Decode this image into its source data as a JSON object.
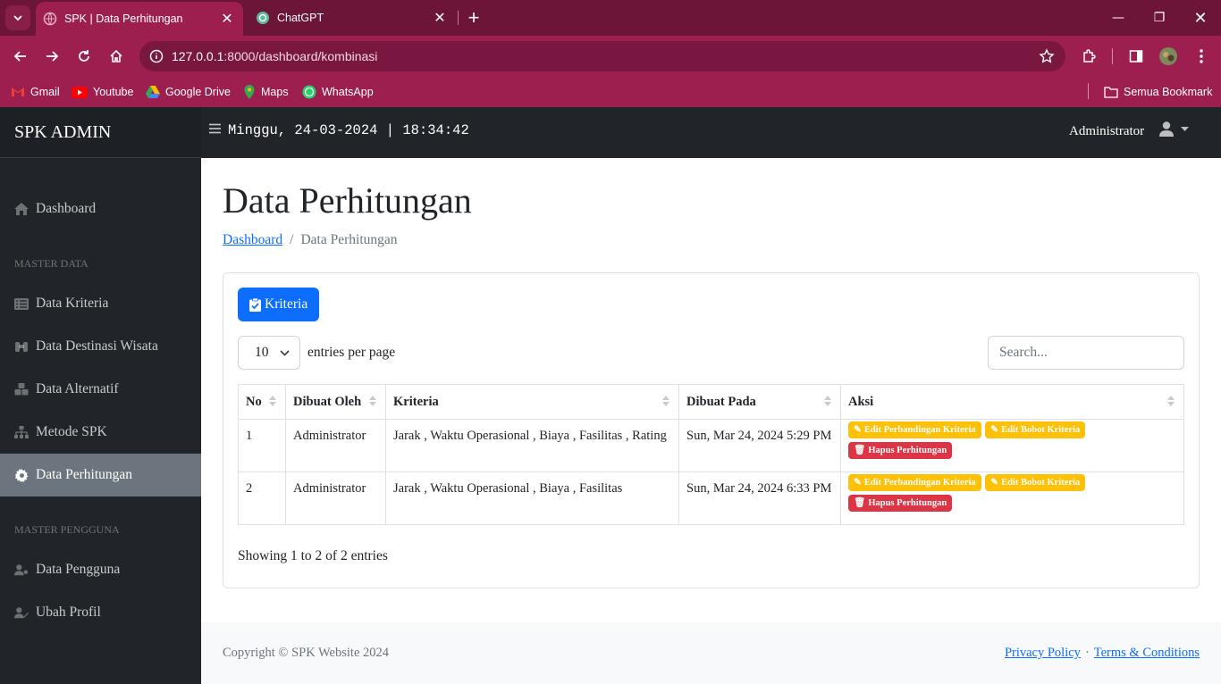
{
  "browser": {
    "tabs": [
      {
        "title": "SPK | Data Perhitungan"
      },
      {
        "title": "ChatGPT"
      }
    ],
    "url": {
      "host": "127.0.0.1",
      "rest": ":8000/dashboard/kombinasi"
    },
    "bookmarks": [
      {
        "label": "Gmail",
        "icon": "gmail-icon"
      },
      {
        "label": "Youtube",
        "icon": "youtube-icon"
      },
      {
        "label": "Google Drive",
        "icon": "google-drive-icon"
      },
      {
        "label": "Maps",
        "icon": "maps-icon"
      },
      {
        "label": "WhatsApp",
        "icon": "whatsapp-icon"
      }
    ],
    "all_bookmarks": "Semua Bookmark"
  },
  "app": {
    "brand": "SPK ADMIN",
    "datetime": "Minggu, 24-03-2024 | 18:34:42",
    "user": "Administrator"
  },
  "sidebar": {
    "dashboard": "Dashboard",
    "heading_master_data": "MASTER DATA",
    "items": [
      {
        "label": "Data Kriteria",
        "icon": "table-list-icon"
      },
      {
        "label": "Data Destinasi Wisata",
        "icon": "binoculars-icon"
      },
      {
        "label": "Data Alternatif",
        "icon": "cubes-icon"
      },
      {
        "label": "Metode SPK",
        "icon": "sitemap-icon"
      },
      {
        "label": "Data Perhitungan",
        "icon": "gear-icon",
        "active": true
      }
    ],
    "heading_master_pengguna": "MASTER PENGGUNA",
    "user_items": [
      {
        "label": "Data Pengguna",
        "icon": "user-gear-icon"
      },
      {
        "label": "Ubah Profil",
        "icon": "user-edit-icon"
      }
    ]
  },
  "page": {
    "title": "Data Perhitungan",
    "breadcrumb": {
      "link": "Dashboard",
      "separator": "/",
      "current": "Data Perhitungan"
    },
    "kriteria_button": "Kriteria",
    "per_page_value": "10",
    "per_page_label": "entries per page",
    "search_placeholder": "Search...",
    "columns": [
      "No",
      "Dibuat Oleh",
      "Kriteria",
      "Dibuat Pada",
      "Aksi"
    ],
    "rows": [
      {
        "no": "1",
        "by": "Administrator",
        "kriteria": "Jarak , Waktu Operasional , Biaya , Fasilitas , Rating",
        "date": "Sun, Mar 24, 2024 5:29 PM"
      },
      {
        "no": "2",
        "by": "Administrator",
        "kriteria": "Jarak , Waktu Operasional , Biaya , Fasilitas",
        "date": "Sun, Mar 24, 2024 6:33 PM"
      }
    ],
    "actions": {
      "edit_perbandingan": "Edit Perbandingan Kriteria",
      "edit_bobot": "Edit Bobot Kriteria",
      "hapus": "Hapus Perhitungan"
    },
    "showing": "Showing 1 to 2 of 2 entries"
  },
  "footer": {
    "copyright": "Copyright © SPK Website 2024",
    "privacy": "Privacy Policy",
    "separator": "·",
    "terms": "Terms & Conditions"
  },
  "colors": {
    "chrome_dark": "#6c1538",
    "chrome": "#9c1f50",
    "sidebar": "#212529",
    "primary": "#0d6efd",
    "warning": "#ffc107",
    "danger": "#dc3545"
  }
}
